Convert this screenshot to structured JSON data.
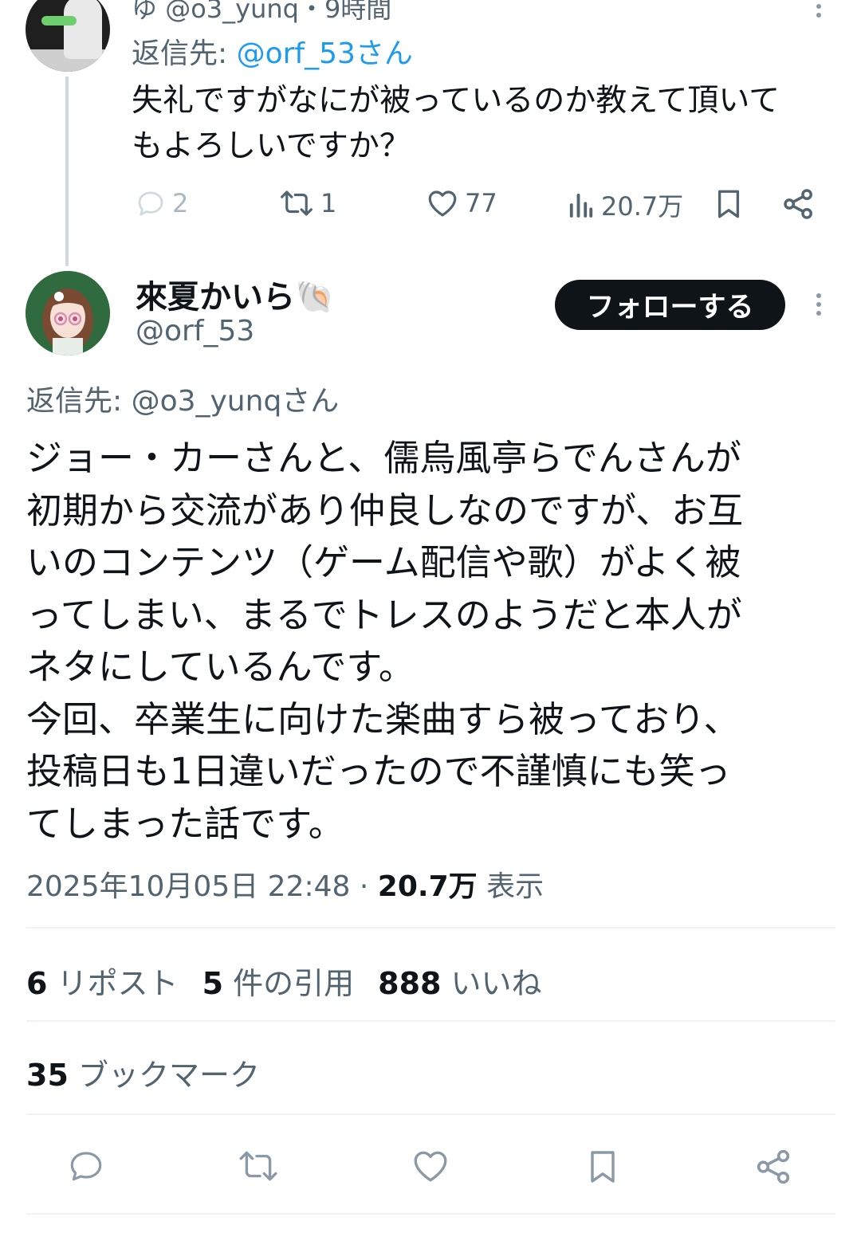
{
  "parent_tweet": {
    "handle": "@o3_yunq",
    "time": "・9時間",
    "reply_to_label": "返信先:",
    "reply_to_handle": "@orf_53さん",
    "text": "失礼ですがなにが被っているのか教えて頂いて\nもよろしいですか？",
    "replies": "2",
    "reposts": "1",
    "likes": "77",
    "views": "20.7万"
  },
  "main_tweet": {
    "display_name": "來夏かいら",
    "name_emoji": "🐚",
    "handle": "@orf_53",
    "follow_label": "フォローする",
    "reply_to": "返信先: @o3_yunqさん",
    "text": "ジョー・カーさんと、儒烏風亭らでんさんが\n初期から交流があり仲良しなのですが、お互\nいのコンテンツ（ゲーム配信や歌）がよく被\nってしまい、まるでトレスのようだと本人が\nネタにしているんです。\n今回、卒業生に向けた楽曲すら被っており、\n投稿日も1日違いだったので不謹慎にも笑っ\nてしまった話です。",
    "timestamp": "2025年10月05日 22:48",
    "separator": "·",
    "views_count": "20.7万",
    "views_label": "表示",
    "reposts_count": "6",
    "reposts_label": "リポスト",
    "quotes_count": "5",
    "quotes_label": "件の引用",
    "likes_count": "888",
    "likes_label": "いいね",
    "bookmarks_count": "35",
    "bookmarks_label": "ブックマーク"
  },
  "colors": {
    "text": "#0f1419",
    "secondary": "#536471",
    "link": "#1d9bf0",
    "divider": "#eff3f4",
    "thread_line": "#cfd9de",
    "button_bg": "#0f1419",
    "button_text": "#ffffff"
  },
  "icons": [
    "reply-icon",
    "repost-icon",
    "like-icon",
    "views-icon",
    "bookmark-icon",
    "share-icon",
    "more-icon"
  ]
}
